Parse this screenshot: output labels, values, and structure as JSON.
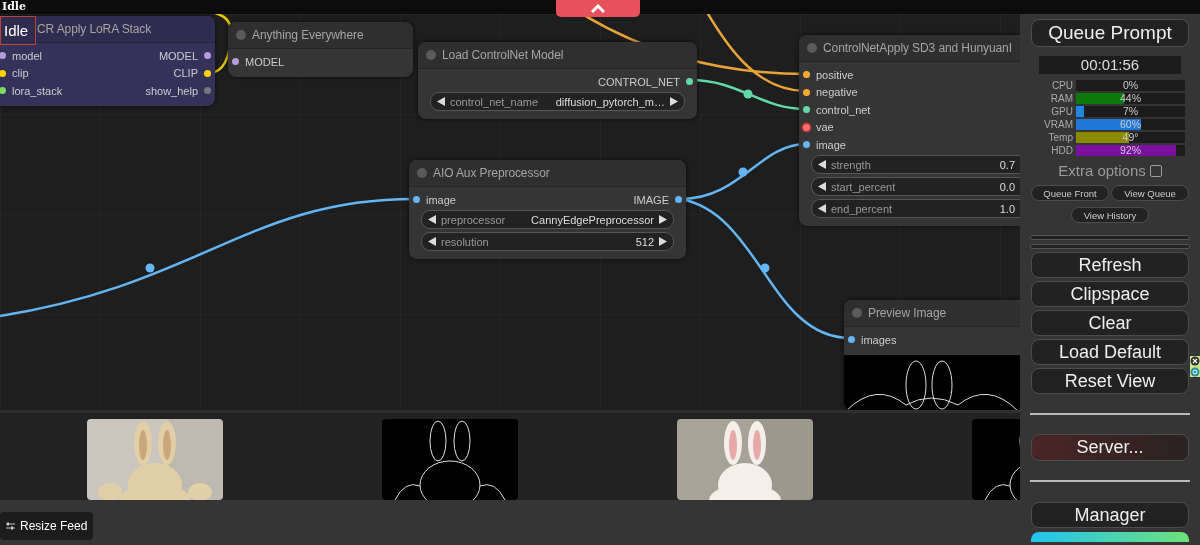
{
  "status_bar": {
    "title": "Idle"
  },
  "canvas": {
    "badge": "Idle",
    "nodes": [
      {
        "title": "CR Apply LoRA Stack",
        "color": "#35325a",
        "clipped": false,
        "inputs": [
          {
            "label": "model",
            "color": "#b39ddb"
          },
          {
            "label": "clip",
            "color": "#ffd500"
          },
          {
            "label": "lora_stack",
            "color": "#7cdc68"
          }
        ],
        "outputs": [
          {
            "label": "MODEL",
            "color": "#b39ddb"
          },
          {
            "label": "CLIP",
            "color": "#ffd500"
          },
          {
            "label": "show_help",
            "color": "#777777"
          }
        ]
      },
      {
        "title": "Anything Everywhere",
        "color": "#353535",
        "clipped": false,
        "inputs": [
          {
            "label": "MODEL",
            "color": "#b39ddb"
          }
        ]
      },
      {
        "title": "Load ControlNet Model",
        "color": "#353535",
        "clipped": false,
        "outputs": [
          {
            "label": "CONTROL_NET",
            "color": "#63d9a8"
          }
        ],
        "widgets": [
          {
            "label": "control_net_name",
            "value": "diffusion_pytorch_m…"
          }
        ]
      },
      {
        "title": "AIO Aux Preprocessor",
        "color": "#353535",
        "clipped": false,
        "inputs": [
          {
            "label": "image",
            "color": "#64b5f6"
          }
        ],
        "outputs": [
          {
            "label": "IMAGE",
            "color": "#64b5f6"
          }
        ],
        "widgets": [
          {
            "label": "preprocessor",
            "value": "CannyEdgePreprocessor"
          },
          {
            "label": "resolution",
            "value": "512"
          }
        ]
      },
      {
        "title": "ControlNetApply SD3 and HunyuanI",
        "color": "#353535",
        "clipped": true,
        "inputs": [
          {
            "label": "positive",
            "color": "#ffa931"
          },
          {
            "label": "negative",
            "color": "#ffa931"
          },
          {
            "label": "control_net",
            "color": "#63d9a8"
          },
          {
            "label": "vae",
            "color": "#ff6e6e"
          },
          {
            "label": "image",
            "color": "#64b5f6"
          }
        ],
        "widgets": [
          {
            "label": "strength",
            "value": "0.7"
          },
          {
            "label": "start_percent",
            "value": "0.0"
          },
          {
            "label": "end_percent",
            "value": "1.0"
          }
        ]
      },
      {
        "title": "Preview Image",
        "color": "#353535",
        "clipped": true,
        "inputs": [
          {
            "label": "images",
            "color": "#64b5f6"
          }
        ],
        "preview": {
          "kind": "picture"
        }
      }
    ]
  },
  "feed": {
    "images": [
      {
        "kind": "picture"
      },
      {
        "kind": "picture"
      },
      {
        "kind": "picture"
      },
      {
        "kind": "picture"
      }
    ],
    "resize_button": "Resize Feed"
  },
  "side_panel": {
    "queue_button": "Queue Prompt",
    "timer": "00:01:56",
    "stats": [
      {
        "label": "CPU",
        "value": "0%"
      },
      {
        "label": "RAM",
        "value": "44%",
        "level": 0.44,
        "color": "#0b7a0b"
      },
      {
        "label": "GPU",
        "value": "7%",
        "level": 0.07,
        "color": "#1e88e5"
      },
      {
        "label": "VRAM",
        "value": "60%",
        "level": 0.6,
        "color": "#1e78d8"
      },
      {
        "label": "Temp",
        "value": "49°",
        "level": 0.49,
        "color": "#8a8a00"
      },
      {
        "label": "HDD",
        "value": "92%",
        "level": 0.92,
        "color": "#7a10a0"
      }
    ],
    "extra_options": {
      "label": "Extra options",
      "checked": false
    },
    "small_buttons": [
      "Queue Front",
      "View Queue"
    ],
    "history_button": "View History",
    "buttons": [
      "Refresh",
      "Clipspace",
      "Clear",
      "Load Default",
      "Reset View"
    ],
    "server_button": "Server...",
    "manager_button": "Manager"
  }
}
